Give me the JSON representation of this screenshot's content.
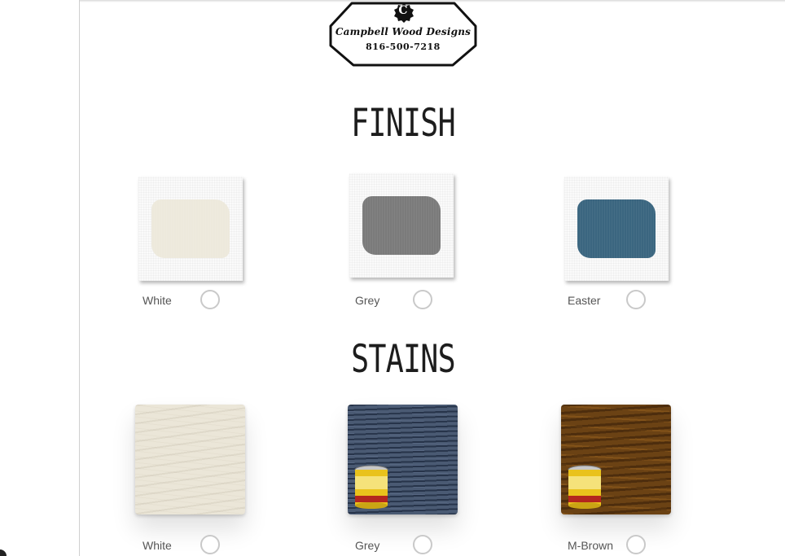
{
  "logo": {
    "brand": "Campbell Wood Designs",
    "phone": "816-500-7218",
    "mark": "C"
  },
  "finish": {
    "title": "FINISH",
    "options": [
      {
        "label": "White",
        "color": "#ede9dc",
        "selected": false
      },
      {
        "label": "Grey",
        "color": "#7b7b7b",
        "selected": false
      },
      {
        "label": "Easter",
        "color": "#3b6680",
        "selected": false
      }
    ]
  },
  "stains": {
    "title": "STAINS",
    "options": [
      {
        "label": "White",
        "selected": false
      },
      {
        "label": "Grey",
        "selected": false
      },
      {
        "label": "M-Brown",
        "selected": false
      }
    ]
  },
  "colors": {
    "radio_border": "#c9c9c9",
    "label_text": "#555555",
    "title_text": "#1d1d1d"
  }
}
